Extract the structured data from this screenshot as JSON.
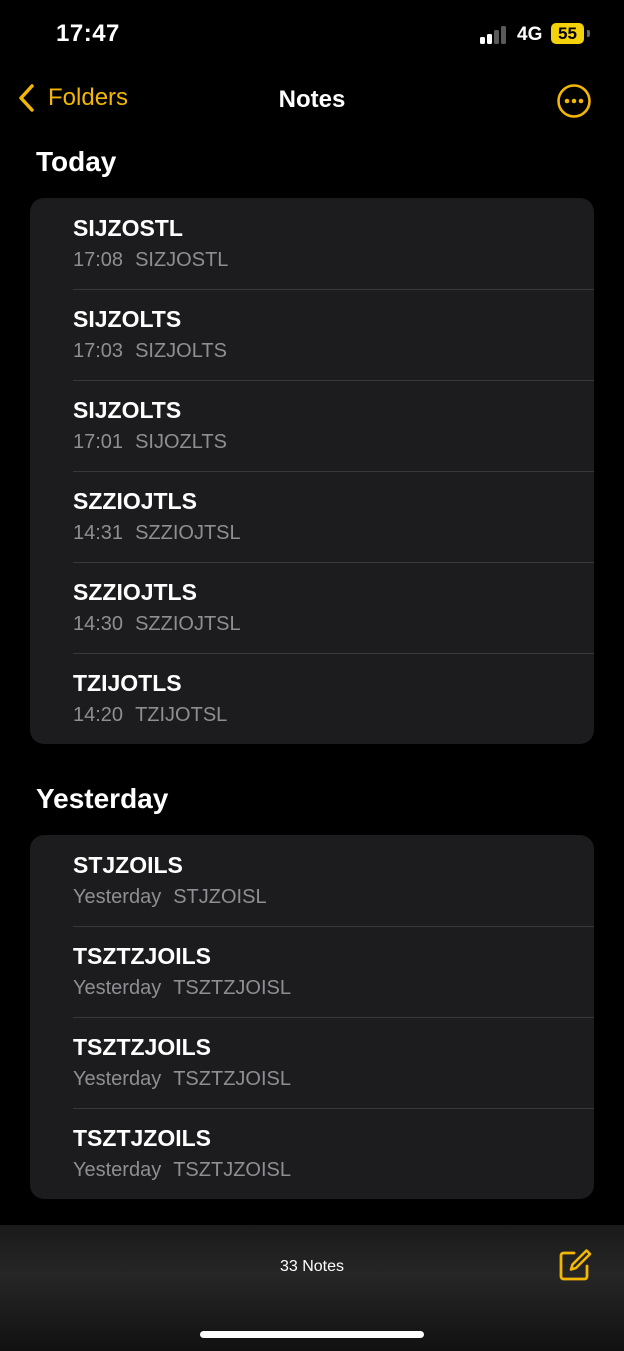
{
  "status": {
    "time": "17:47",
    "network": "4G",
    "battery": "55"
  },
  "nav": {
    "back_label": "Folders",
    "title": "Notes"
  },
  "sections": [
    {
      "title": "Today",
      "notes": [
        {
          "title": "SIJZOSTL",
          "date": "17:08",
          "preview": "SIZJOSTL"
        },
        {
          "title": "SIJZOLTS",
          "date": "17:03",
          "preview": "SIZJOLTS"
        },
        {
          "title": "SIJZOLTS",
          "date": "17:01",
          "preview": "SIJOZLTS"
        },
        {
          "title": "SZZIOJTLS",
          "date": "14:31",
          "preview": "SZZIOJTSL"
        },
        {
          "title": "SZZIOJTLS",
          "date": "14:30",
          "preview": "SZZIOJTSL"
        },
        {
          "title": "TZIJOTLS",
          "date": "14:20",
          "preview": "TZIJOTSL"
        }
      ]
    },
    {
      "title": "Yesterday",
      "notes": [
        {
          "title": "STJZOILS",
          "date": "Yesterday",
          "preview": "STJZOISL"
        },
        {
          "title": "TSZTZJOILS",
          "date": "Yesterday",
          "preview": "TSZTZJOISL"
        },
        {
          "title": "TSZTZJOILS",
          "date": "Yesterday",
          "preview": "TSZTZJOISL"
        },
        {
          "title": "TSZTJZOILS",
          "date": "Yesterday",
          "preview": "TSZTJZOISL"
        }
      ]
    }
  ],
  "footer": {
    "count": "33 Notes"
  },
  "colors": {
    "accent": "#f2b705",
    "card": "#1c1c1e",
    "secondary_text": "#8e8e93",
    "battery": "#f4d20b"
  }
}
